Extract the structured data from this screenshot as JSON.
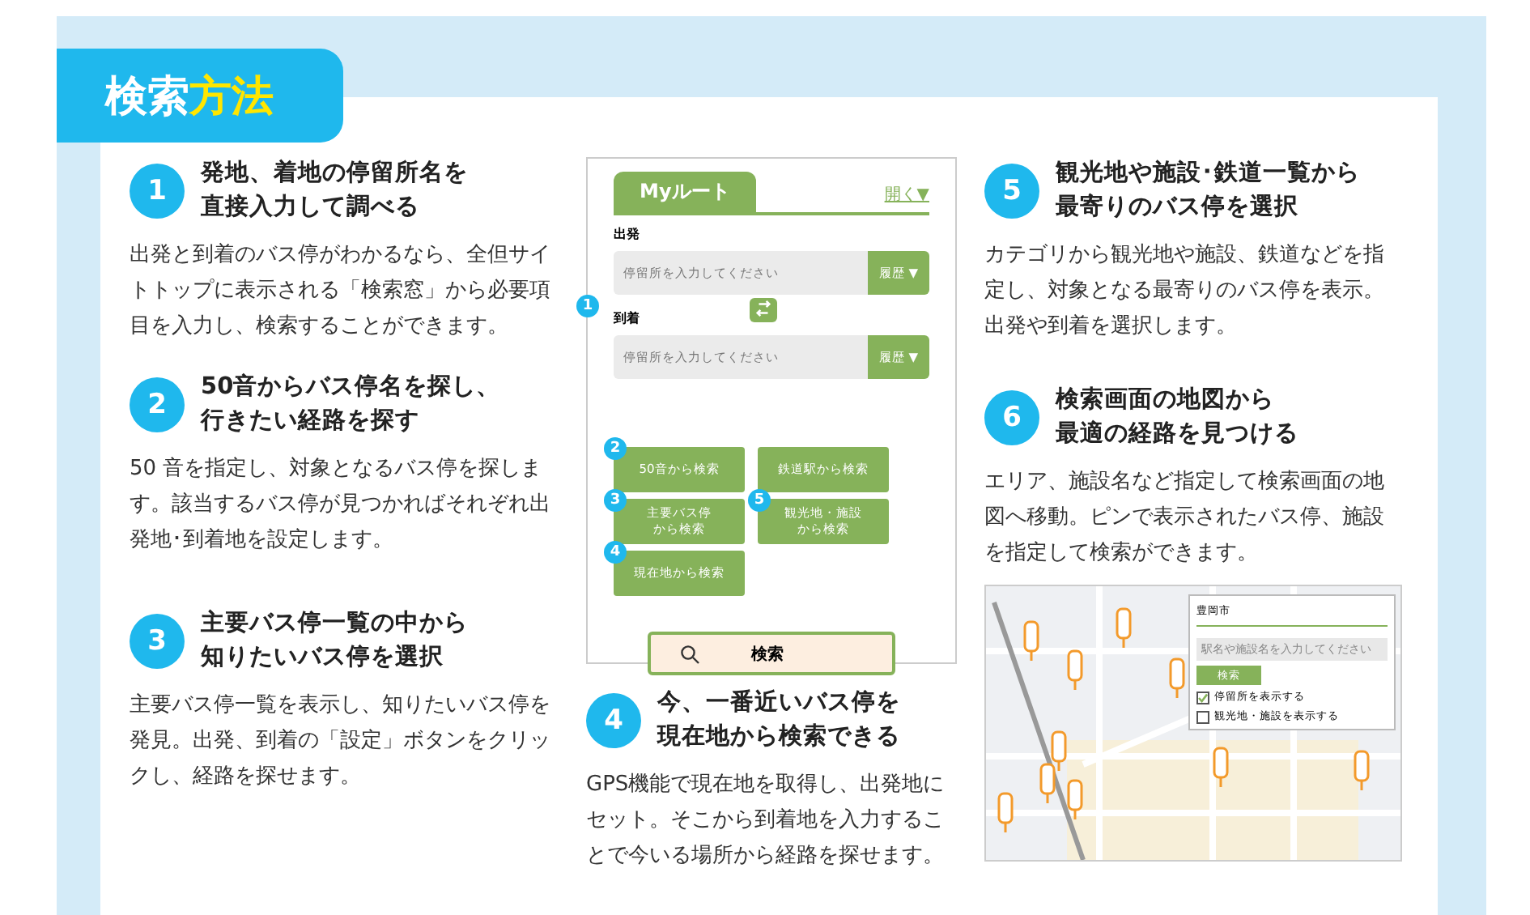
{
  "title": {
    "main": "検索",
    "accent": "方法"
  },
  "sections": [
    {
      "number": "1",
      "heading": [
        "発地、着地の停留所名を",
        "直接入力して調べる"
      ],
      "body": "出発と到着のバス停がわかるなら、全但サイトトップに表示される「検索窓」から必要項目を入力し、検索することができます。"
    },
    {
      "number": "2",
      "heading": [
        "50音からバス停名を探し、",
        "行きたい経路を探す"
      ],
      "body": "50 音を指定し、対象となるバス停を探します。該当するバス停が見つかればそれぞれ出発地･到着地を設定します。"
    },
    {
      "number": "3",
      "heading": [
        "主要バス停一覧の中から",
        "知りたいバス停を選択"
      ],
      "body": "主要バス停一覧を表示し、知りたいバス停を発見。出発、到着の「設定」ボタンをクリックし、経路を探せます。"
    },
    {
      "number": "4",
      "heading": [
        "今、一番近いバス停を",
        "現在地から検索できる"
      ],
      "body": "GPS機能で現在地を取得し、出発地にセット。そこから到着地を入力することで今いる場所から経路を探せます。"
    },
    {
      "number": "5",
      "heading": [
        "観光地や施設･鉄道一覧から",
        "最寄りのバス停を選択"
      ],
      "body": "カテゴリから観光地や施設、鉄道などを指定し、対象となる最寄りのバス停を表示。出発や到着を選択します。"
    },
    {
      "number": "6",
      "heading": [
        "検索画面の地図から",
        "最適の経路を見つける"
      ],
      "body": "エリア、施設名など指定して検索画面の地図へ移動。ピンで表示されたバス停、施設を指定して検索ができます。"
    }
  ],
  "mock": {
    "tab": "Myルート",
    "open_link": "開く▼",
    "badge": "1",
    "fields": [
      {
        "label": "出発",
        "placeholder": "停留所を入力してください",
        "history": "履歴 ▼"
      },
      {
        "label": "到着",
        "placeholder": "停留所を入力してください",
        "history": "履歴 ▼"
      }
    ],
    "buttons": [
      {
        "badge": "2",
        "lines": [
          "50音から検索"
        ]
      },
      {
        "lines": [
          "鉄道駅から検索"
        ]
      },
      {
        "badge": "3",
        "lines": [
          "主要バス停",
          "から検索"
        ]
      },
      {
        "badge": "5",
        "lines": [
          "観光地・施設",
          "から検索"
        ]
      },
      {
        "badge": "4",
        "lines": [
          "現在地から検索"
        ]
      }
    ],
    "search": "検索"
  },
  "map_panel": {
    "area": "豊岡市",
    "placeholder": "駅名や施設名を入力してください",
    "button": "検索",
    "options": [
      {
        "label": "停留所を表示する",
        "checked": true
      },
      {
        "label": "観光地・施設を表示する",
        "checked": false
      }
    ]
  }
}
